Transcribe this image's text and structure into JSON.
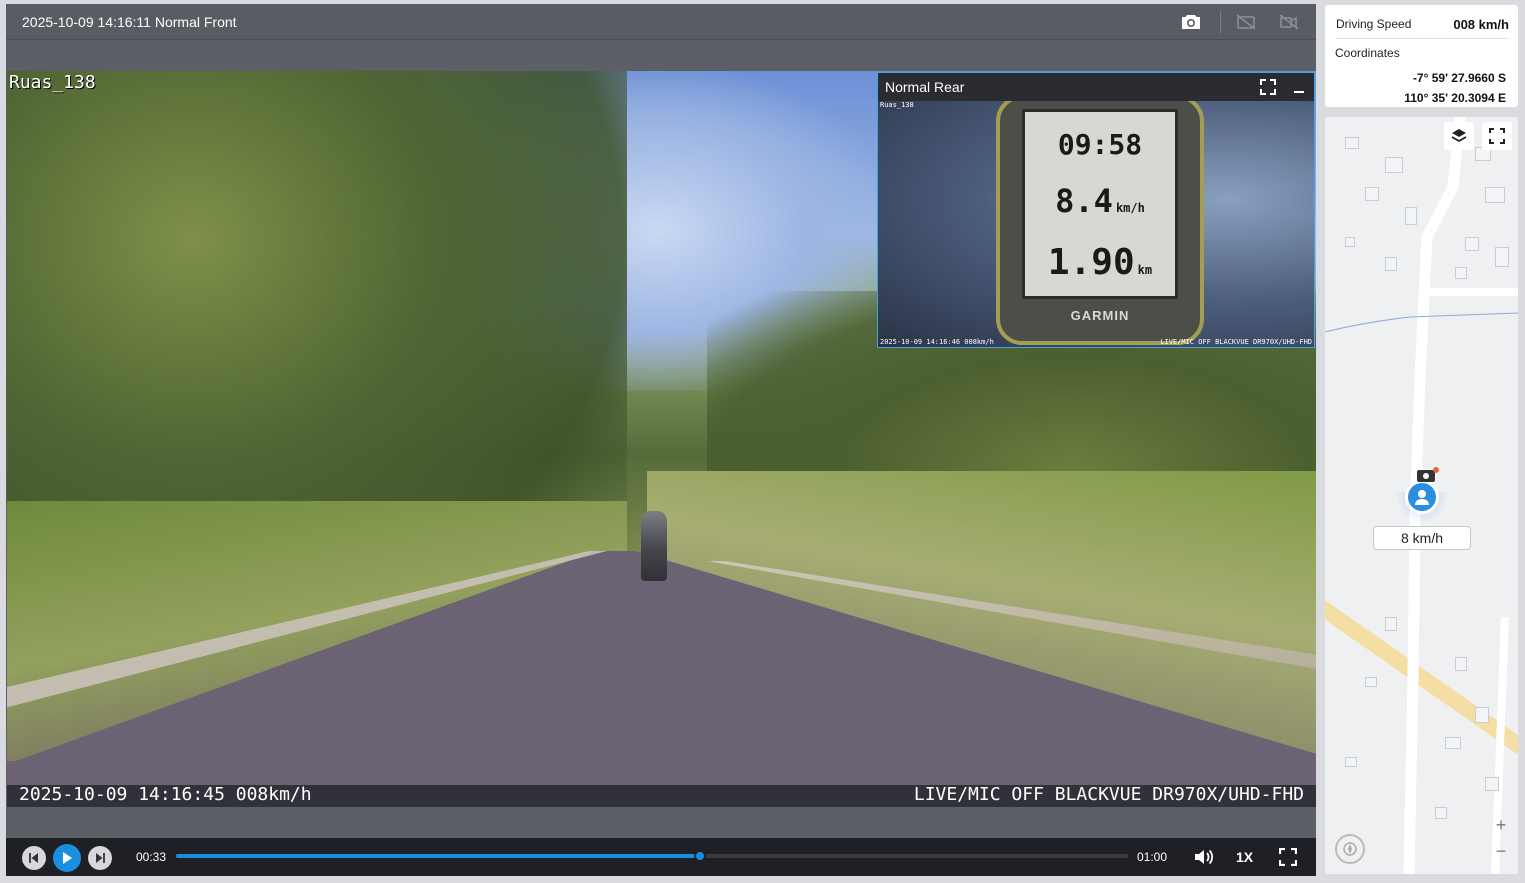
{
  "player": {
    "title": "2025-10-09 14:16:11 Normal Front",
    "camera_id": "Ruas_138",
    "osd_left": "2025-10-09 14:16:45 008km/h",
    "osd_right": "LIVE/MIC OFF BLACKVUE DR970X/UHD-FHD"
  },
  "rear": {
    "title": "Normal Rear",
    "camera_id": "Ruas_138",
    "osd_left": "2025-10-09 14:16:46 008km/h",
    "osd_right": "LIVE/MIC OFF BLACKVUE DR970X/UHD-FHD",
    "gps_time": "09:58",
    "gps_speed": "8.4",
    "gps_speed_unit": "km/h",
    "gps_distance": "1.90",
    "gps_distance_unit": "km",
    "gps_brand": "GARMIN"
  },
  "controls": {
    "current_time": "00:33",
    "total_time": "01:00",
    "progress_fraction": 0.55,
    "speed": "1X"
  },
  "info": {
    "driving_speed_label": "Driving Speed",
    "driving_speed_value": "008 km/h",
    "coordinates_label": "Coordinates",
    "latitude": "-7° 59' 27.9660 S",
    "longitude": "110° 35' 20.3094 E"
  },
  "map": {
    "speed_label": "8 km/h",
    "zoom_in": "+",
    "zoom_out": "−"
  },
  "colors": {
    "accent": "#1a8fde",
    "pip_border": "#3da7e6"
  }
}
